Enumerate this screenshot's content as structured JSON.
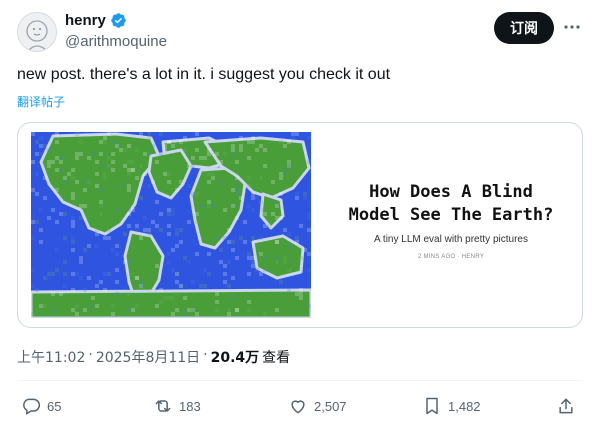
{
  "tweet": {
    "display_name": "henry",
    "handle": "@arithmoquine",
    "follow_label": "订阅",
    "more_label": "⋯",
    "text": "new post. there's a lot in it. i suggest you check it out",
    "translate_label": "翻译帖子"
  },
  "card": {
    "title_line1": "How Does A Blind",
    "title_line2": "Model See The Earth?",
    "subtitle": "A tiny LLM eval with pretty pictures",
    "meta": "2 MINS AGO · HENRY",
    "map_colors": {
      "land": "#4a9e3a",
      "ocean": "#2f55e0",
      "coast": "#c9d6ee"
    }
  },
  "meta": {
    "time": "上午11:02",
    "sep1": "·",
    "date": "2025年8月11日",
    "sep2": "·",
    "views": "20.4万",
    "views_label": "查看"
  },
  "actions": {
    "replies": "65",
    "reposts": "183",
    "likes": "2,507",
    "bookmarks": "1,482"
  },
  "colors": {
    "accent": "#1d9bf0",
    "text": "#0f1419",
    "muted": "#536471"
  }
}
